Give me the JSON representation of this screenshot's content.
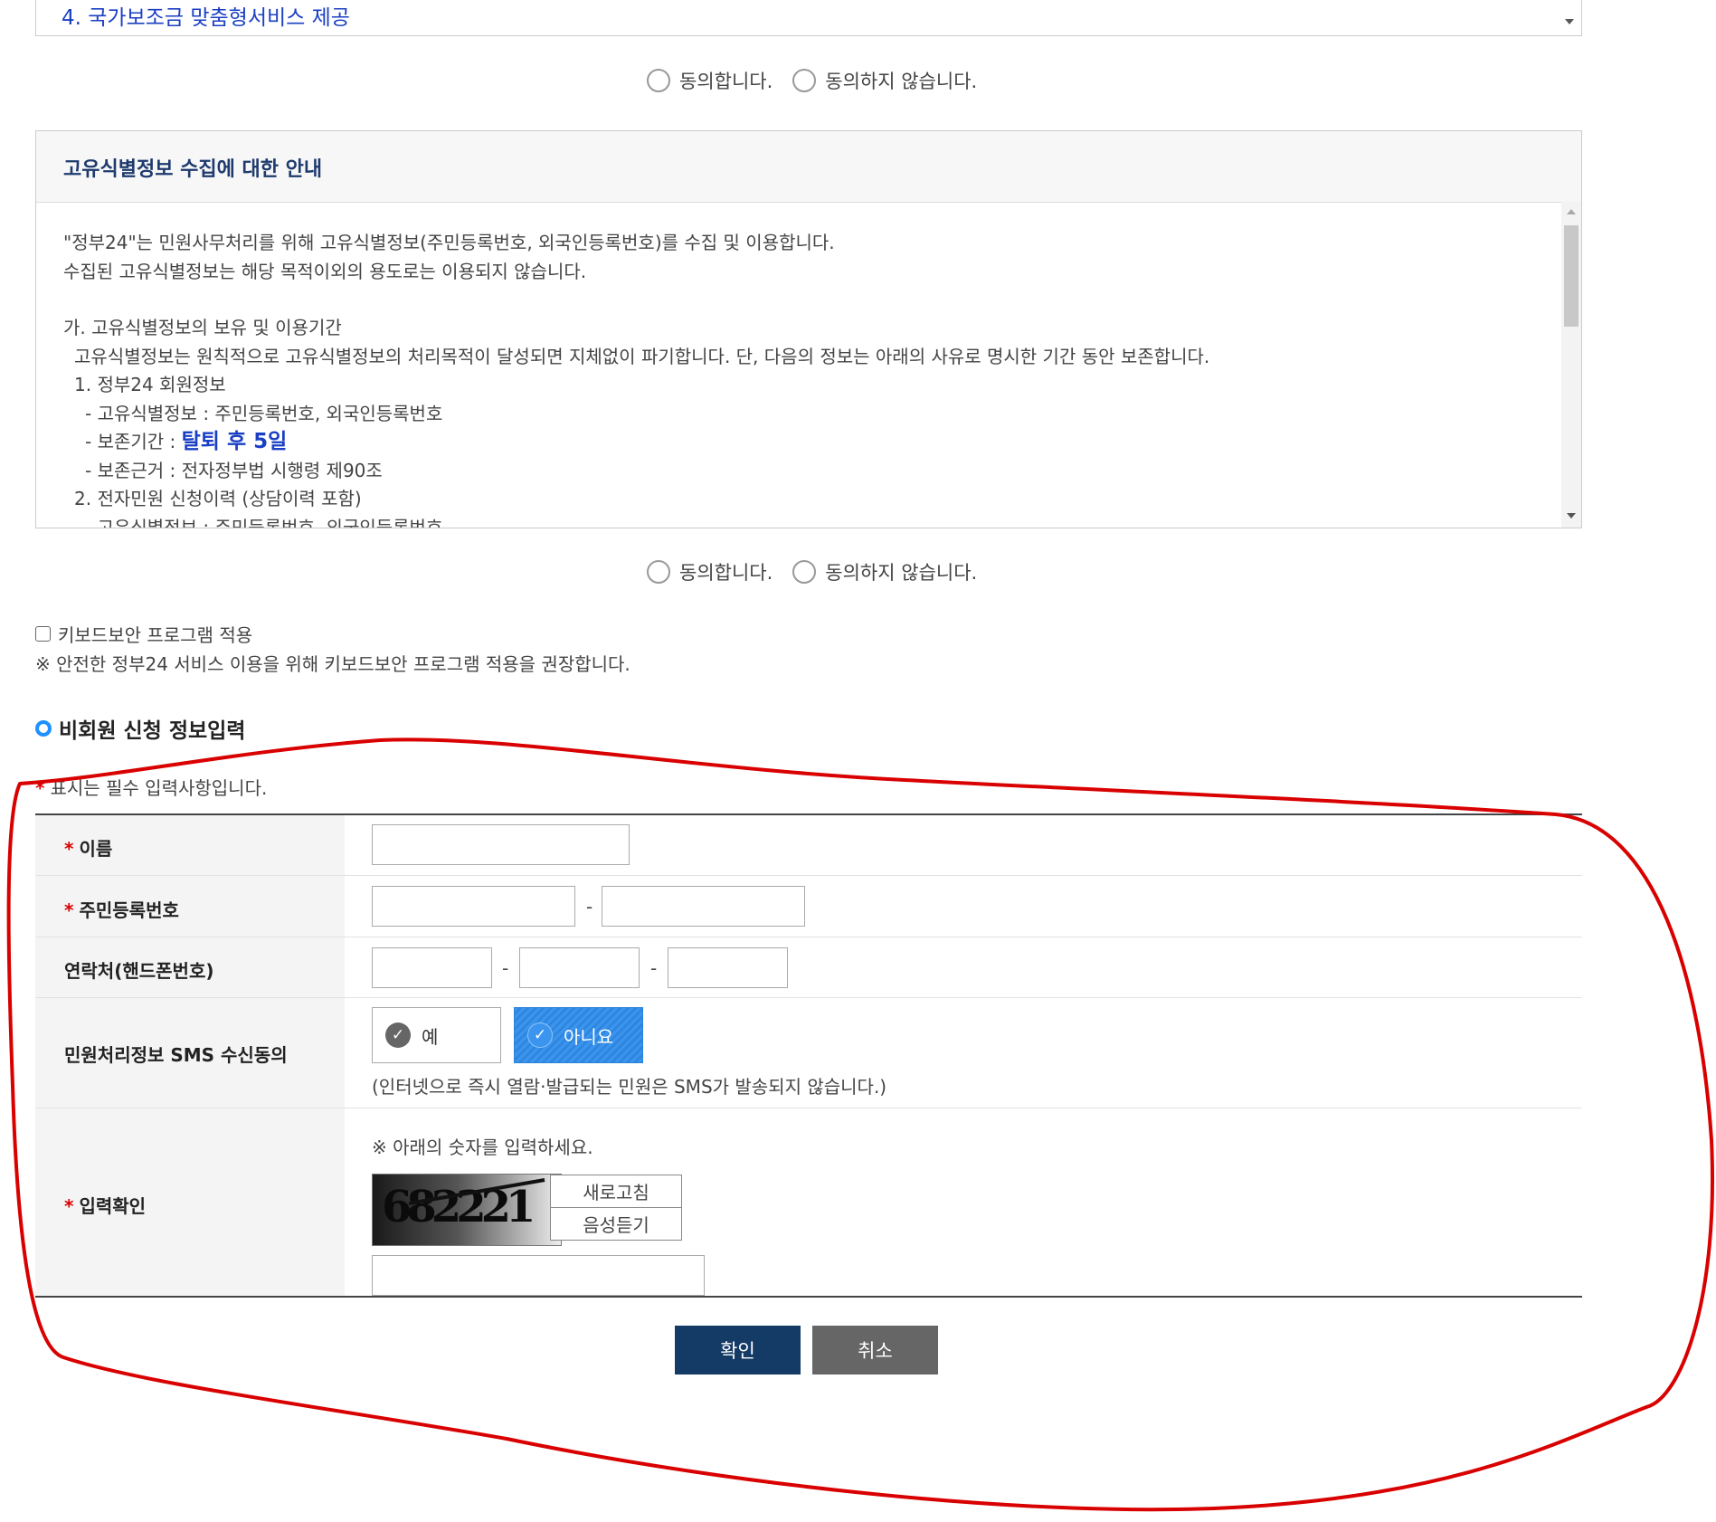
{
  "agreement_list": {
    "item_text": "4. 국가보조금 맞춤형서비스 제공"
  },
  "consent": {
    "agree_label": "동의합니다.",
    "disagree_label": "동의하지 않습니다."
  },
  "unique_id_notice": {
    "title": "고유식별정보 수집에 대한 안내",
    "lines": [
      "\"정부24\"는 민원사무처리를 위해 고유식별정보(주민등록번호, 외국인등록번호)를 수집 및 이용합니다.",
      "수집된 고유식별정보는 해당 목적이외의 용도로는 이용되지 않습니다.",
      "가. 고유식별정보의 보유 및 이용기간",
      "고유식별정보는 원칙적으로 고유식별정보의 처리목적이 달성되면 지체없이 파기합니다. 단, 다음의 정보는 아래의 사유로 명시한 기간 동안 보존합니다.",
      "1. 정부24 회원정보",
      "- 고유식별정보 : 주민등록번호, 외국인등록번호",
      "- 보존기간 :",
      "탈퇴 후 5일",
      "- 보존근거 : 전자정부법 시행령 제90조",
      "2. 전자민원 신청이력 (상담이력 포함)",
      "- 고유식별정보 : 주민등록번호, 외국인등록번호"
    ]
  },
  "keyboard_security": {
    "checkbox_label": "키보드보안 프로그램 적용",
    "notice": "※ 안전한 정부24 서비스 이용을 위해 키보드보안 프로그램 적용을 권장합니다."
  },
  "nonmember_section": {
    "heading": "비회원 신청 정보입력",
    "required_note": "표시는 필수 입력사항입니다.",
    "required_mark": "*"
  },
  "form": {
    "name_label": "이름",
    "rrn_label": "주민등록번호",
    "phone_label": "연락처(핸드폰번호)",
    "sms_label": "민원처리정보 SMS 수신동의",
    "sms_yes": "예",
    "sms_no": "아니요",
    "sms_note": "(인터넷으로 즉시 열람·발급되는 민원은 SMS가 발송되지 않습니다.)",
    "captcha_label": "입력확인",
    "captcha_instruction": "※ 아래의 숫자를 입력하세요.",
    "captcha_value": "682221",
    "refresh_button": "새로고침",
    "audio_button": "음성듣기",
    "dash": "-"
  },
  "actions": {
    "confirm": "확인",
    "cancel": "취소"
  },
  "colors": {
    "confirm_bg": "#143a66",
    "cancel_bg": "#666666",
    "annotation_red": "#d90000",
    "selected_blue": "#3b95ee"
  }
}
